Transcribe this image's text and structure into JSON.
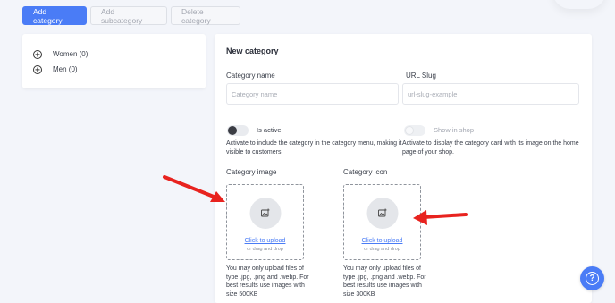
{
  "toolbar": {
    "add_category": "Add category",
    "add_subcategory": "Add subcategory",
    "delete_category": "Delete category"
  },
  "categories": [
    {
      "label": "Women (0)"
    },
    {
      "label": "Men (0)"
    }
  ],
  "form": {
    "title": "New category",
    "category_name_label": "Category name",
    "category_name_placeholder": "Category name",
    "url_slug_label": "URL Slug",
    "url_slug_placeholder": "url-slug-example",
    "is_active_label": "Is active",
    "is_active_desc": "Activate to include the category in the category menu, making it visible to customers.",
    "show_in_shop_label": "Show in shop",
    "show_in_shop_desc": "Activate to display the category card with its image on the home page of your shop.",
    "category_image_label": "Category image",
    "category_icon_label": "Category icon",
    "upload_link": "Click to upload",
    "upload_sub": "or drag and drop",
    "image_note": "You may only upload files of type .jpg, .png and .webp. For best results use images with size 500KB",
    "icon_note": "You may only upload files of type .jpg, .png and .webp. For best results use images with size 300KB"
  },
  "help": {
    "glyph": "?"
  },
  "colors": {
    "accent": "#4a7cf6",
    "arrow": "#e8231f",
    "background": "#f3f5fa"
  },
  "icons": {
    "category_expand": "plus-circle-icon",
    "upload": "image-add-icon",
    "help": "question-icon"
  }
}
